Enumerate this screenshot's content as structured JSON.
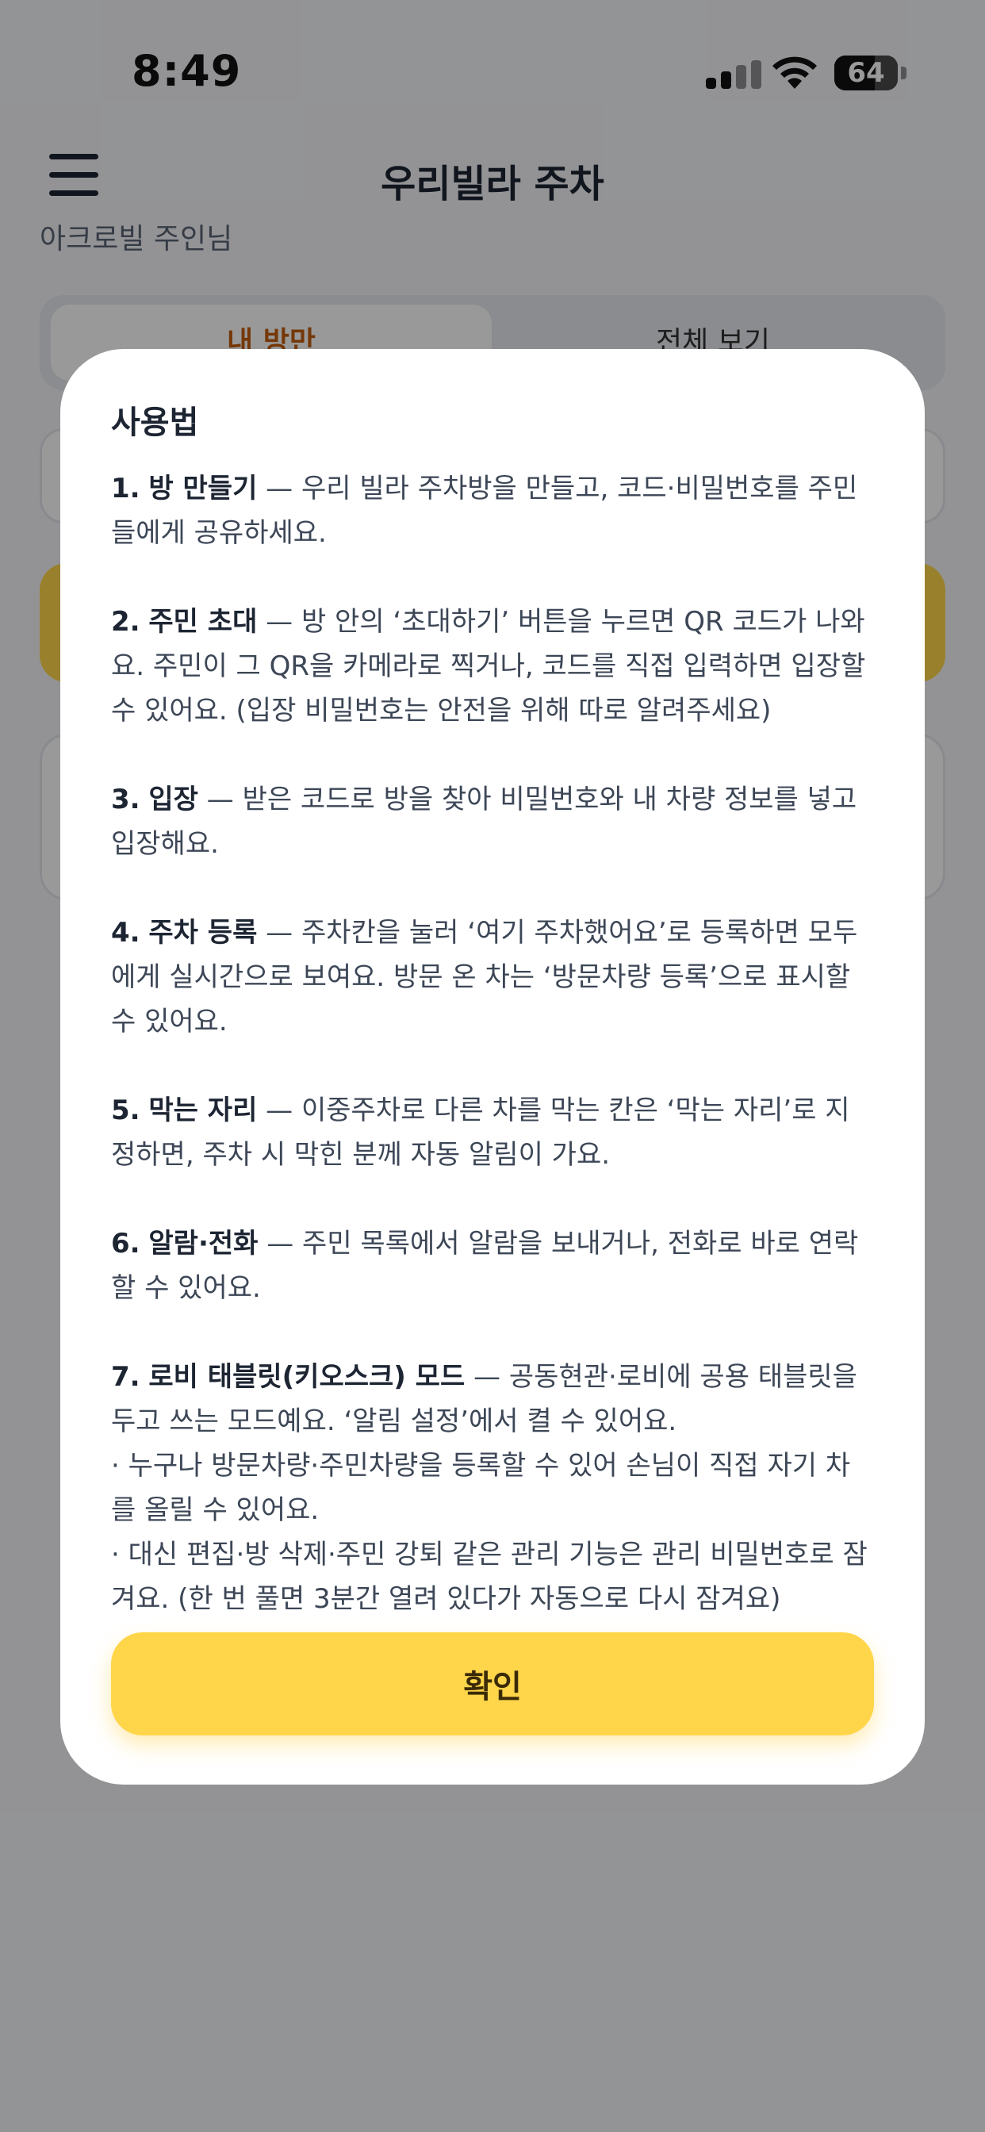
{
  "status": {
    "time": "8:49",
    "battery": "64",
    "battery_level": 0.64
  },
  "header": {
    "title": "우리빌라 주차",
    "subtitle": "아크로빌 주인님"
  },
  "tabs": [
    {
      "label": "내 방만"
    },
    {
      "label": "전체 보기"
    }
  ],
  "modal": {
    "title": "사용법",
    "steps": [
      {
        "num": "1.",
        "name": "방 만들기",
        "text": " — 우리 빌라 주차방을 만들고, 코드·비밀번호를 주민들에게 공유하세요."
      },
      {
        "num": "2.",
        "name": "주민 초대",
        "text": " — 방 안의 ‘초대하기’ 버튼을 누르면 QR 코드가 나와요. 주민이 그 QR을 카메라로 찍거나, 코드를 직접 입력하면 입장할 수 있어요. (입장 비밀번호는 안전을 위해 따로 알려주세요)"
      },
      {
        "num": "3.",
        "name": "입장",
        "text": " — 받은 코드로 방을 찾아 비밀번호와 내 차량 정보를 넣고 입장해요."
      },
      {
        "num": "4.",
        "name": "주차 등록",
        "text": " — 주차칸을 눌러 ‘여기 주차했어요’로 등록하면 모두에게 실시간으로 보여요. 방문 온 차는 ‘방문차량 등록’으로 표시할 수 있어요."
      },
      {
        "num": "5.",
        "name": "막는 자리",
        "text": " — 이중주차로 다른 차를 막는 칸은 ‘막는 자리’로 지정하면, 주차 시 막힌 분께 자동 알림이 가요."
      },
      {
        "num": "6.",
        "name": "알람·전화",
        "text": " — 주민 목록에서 알람을 보내거나, 전화로 바로 연락할 수 있어요."
      },
      {
        "num": "7.",
        "name": "로비 태블릿(키오스크) 모드",
        "text": " — 공동현관·로비에 공용 태블릿을 두고 쓰는 모드예요. ‘알림 설정’에서 켤 수 있어요.",
        "bullets": [
          "· 누구나 방문차량·주민차량을 등록할 수 있어 손님이 직접 자기 차를 올릴 수 있어요.",
          "· 대신 편집·방 삭제·주민 강퇴 같은 관리 기능은 관리 비밀번호로 잠겨요. (한 번 풀면 3분간 열려 있다가 자동으로 다시 잠겨요)"
        ]
      }
    ],
    "confirm_label": "확인"
  }
}
